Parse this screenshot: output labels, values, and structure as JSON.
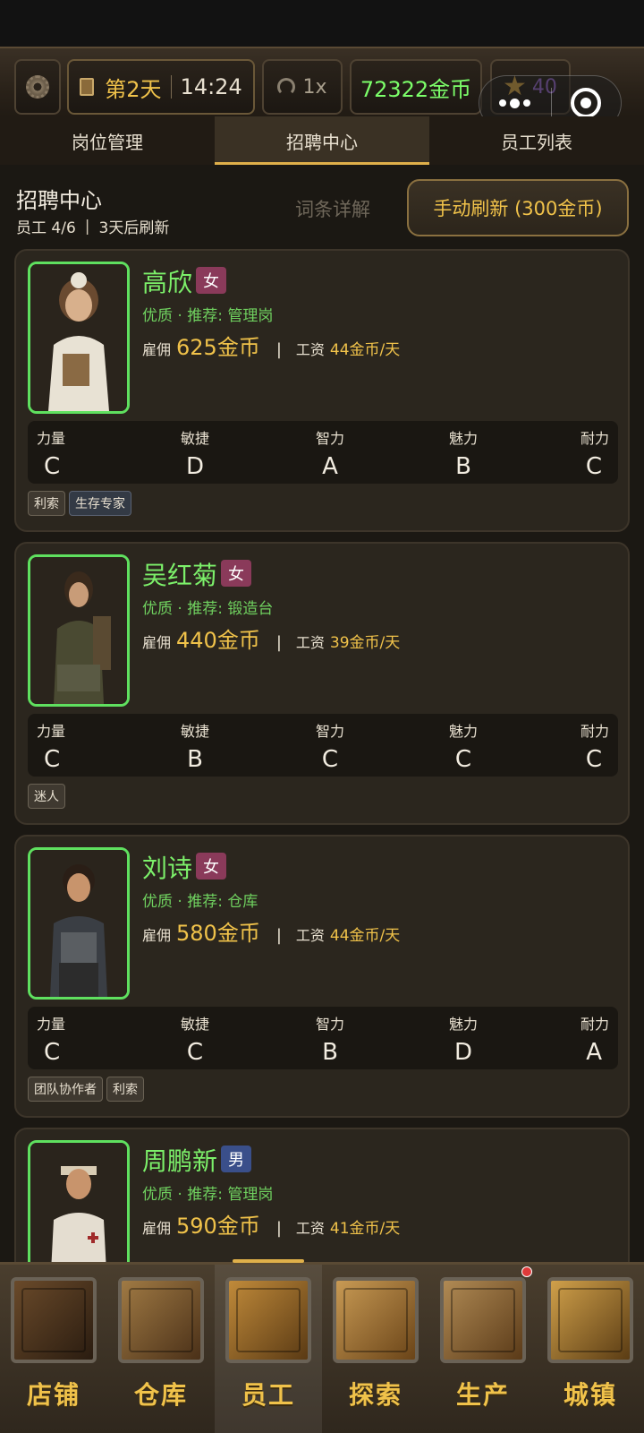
{
  "hud": {
    "day": "第2天",
    "time": "14:24",
    "speed": "1x",
    "gold": "72322金币",
    "rating": "40"
  },
  "tabs": [
    {
      "label": "岗位管理"
    },
    {
      "label": "招聘中心"
    },
    {
      "label": "员工列表"
    }
  ],
  "section": {
    "title": "招聘中心",
    "staff_count": "员工 4/6",
    "refresh_info": "3天后刷新",
    "terms_link": "词条详解",
    "refresh_button": "手动刷新 (300金币)"
  },
  "stat_names": [
    "力量",
    "敏捷",
    "智力",
    "魅力",
    "耐力"
  ],
  "candidates": [
    {
      "name": "高欣",
      "gender": "女",
      "quality_line": "优质 · 推荐: 管理岗",
      "hire_label": "雇佣",
      "hire_cost": "625金币",
      "wage_label": "工资",
      "wage": "44金币/天",
      "stats": [
        "C",
        "D",
        "A",
        "B",
        "C"
      ],
      "traits": [
        "利索",
        "生存专家"
      ]
    },
    {
      "name": "吴红菊",
      "gender": "女",
      "quality_line": "优质 · 推荐: 锻造台",
      "hire_label": "雇佣",
      "hire_cost": "440金币",
      "wage_label": "工资",
      "wage": "39金币/天",
      "stats": [
        "C",
        "B",
        "C",
        "C",
        "C"
      ],
      "traits": [
        "迷人"
      ]
    },
    {
      "name": "刘诗",
      "gender": "女",
      "quality_line": "优质 · 推荐: 仓库",
      "hire_label": "雇佣",
      "hire_cost": "580金币",
      "wage_label": "工资",
      "wage": "44金币/天",
      "stats": [
        "C",
        "C",
        "B",
        "D",
        "A"
      ],
      "traits": [
        "团队协作者",
        "利索"
      ]
    },
    {
      "name": "周鹏新",
      "gender": "男",
      "quality_line": "优质 · 推荐: 管理岗",
      "hire_label": "雇佣",
      "hire_cost": "590金币",
      "wage_label": "工资",
      "wage": "41金币/天"
    }
  ],
  "nav": [
    {
      "label": "店铺",
      "icon": "shop-icon"
    },
    {
      "label": "仓库",
      "icon": "warehouse-icon"
    },
    {
      "label": "员工",
      "icon": "staff-icon"
    },
    {
      "label": "探索",
      "icon": "explore-icon"
    },
    {
      "label": "生产",
      "icon": "production-icon"
    },
    {
      "label": "城镇",
      "icon": "town-icon"
    }
  ],
  "colors": {
    "gold": "#f0c24a",
    "green": "#7cf06a",
    "female_tag": "#8a3a5a",
    "male_tag": "#3a4f8a",
    "portrait_border": "#5fe05f"
  }
}
